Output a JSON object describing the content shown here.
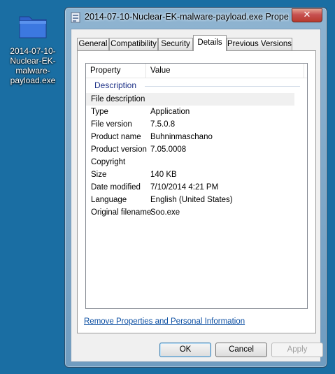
{
  "desktop": {
    "icon_name": "folder-icon",
    "icon_label": "2014-07-10-Nuclear-EK-malware-payload.exe"
  },
  "window": {
    "title": "2014-07-10-Nuclear-EK-malware-payload.exe Proper...",
    "close_label": "✕"
  },
  "tabs": [
    {
      "label": "General"
    },
    {
      "label": "Compatibility"
    },
    {
      "label": "Security"
    },
    {
      "label": "Details",
      "active": true
    },
    {
      "label": "Previous Versions"
    }
  ],
  "details": {
    "columns": [
      "Property",
      "Value"
    ],
    "group": "Description",
    "rows": [
      {
        "property": "File description",
        "value": "",
        "selected": true
      },
      {
        "property": "Type",
        "value": "Application"
      },
      {
        "property": "File version",
        "value": "7.5.0.8"
      },
      {
        "property": "Product name",
        "value": "Buhninmaschano"
      },
      {
        "property": "Product version",
        "value": "7.05.0008"
      },
      {
        "property": "Copyright",
        "value": ""
      },
      {
        "property": "Size",
        "value": "140 KB"
      },
      {
        "property": "Date modified",
        "value": "7/10/2014 4:21 PM"
      },
      {
        "property": "Language",
        "value": "English (United States)"
      },
      {
        "property": "Original filename",
        "value": "Soo.exe"
      }
    ]
  },
  "remove_link": "Remove Properties and Personal Information",
  "buttons": {
    "ok": "OK",
    "cancel": "Cancel",
    "apply": "Apply"
  },
  "colors": {
    "desktop": "#1a6ea3",
    "link": "#0b4ea2",
    "group": "#1e3287"
  }
}
